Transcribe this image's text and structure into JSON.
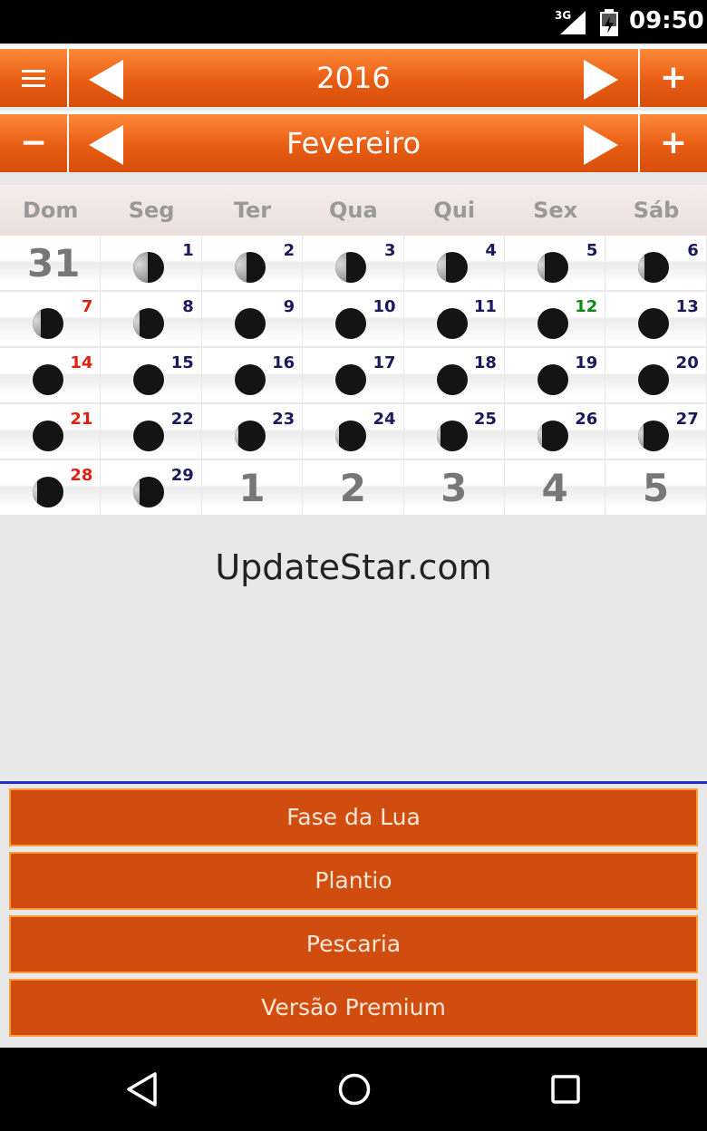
{
  "status_bar": {
    "network": "3G",
    "time": "09:50"
  },
  "year_bar": {
    "title": "2016",
    "menu_icon": "hamburger-menu-icon",
    "plus": "+"
  },
  "month_bar": {
    "title": "Fevereiro",
    "minus": "−",
    "plus": "+"
  },
  "day_names": [
    "Dom",
    "Seg",
    "Ter",
    "Qua",
    "Qui",
    "Sex",
    "Sáb"
  ],
  "calendar": {
    "rows": [
      [
        {
          "label": "31",
          "big": true
        },
        {
          "label": "1",
          "lit": 0.45
        },
        {
          "label": "2",
          "lit": 0.4
        },
        {
          "label": "3",
          "lit": 0.36
        },
        {
          "label": "4",
          "lit": 0.3
        },
        {
          "label": "5",
          "lit": 0.25
        },
        {
          "label": "6",
          "lit": 0.2
        }
      ],
      [
        {
          "label": "7",
          "lit": 0.25,
          "color": "red"
        },
        {
          "label": "8",
          "lit": 0.18
        },
        {
          "label": "9",
          "lit": 0
        },
        {
          "label": "10",
          "lit": 0
        },
        {
          "label": "11",
          "lit": 0
        },
        {
          "label": "12",
          "lit": 0,
          "color": "green"
        },
        {
          "label": "13",
          "lit": 0
        }
      ],
      [
        {
          "label": "14",
          "lit": 0,
          "color": "red"
        },
        {
          "label": "15",
          "lit": 0
        },
        {
          "label": "16",
          "lit": 0
        },
        {
          "label": "17",
          "lit": 0
        },
        {
          "label": "18",
          "lit": 0
        },
        {
          "label": "19",
          "lit": 0
        },
        {
          "label": "20",
          "lit": 0
        }
      ],
      [
        {
          "label": "21",
          "lit": 0,
          "color": "red"
        },
        {
          "label": "22",
          "lit": 0
        },
        {
          "label": "23",
          "lit": 0.12
        },
        {
          "label": "24",
          "lit": 0.12
        },
        {
          "label": "25",
          "lit": 0.14
        },
        {
          "label": "26",
          "lit": 0.16
        },
        {
          "label": "27",
          "lit": 0.18
        }
      ],
      [
        {
          "label": "28",
          "lit": 0.16,
          "color": "red"
        },
        {
          "label": "29",
          "lit": 0.18
        },
        {
          "label": "1",
          "big": true
        },
        {
          "label": "2",
          "big": true
        },
        {
          "label": "3",
          "big": true
        },
        {
          "label": "4",
          "big": true
        },
        {
          "label": "5",
          "big": true
        }
      ]
    ]
  },
  "watermark": "UpdateStar.com",
  "menu_buttons": [
    "Fase da Lua",
    "Plantio",
    "Pescaria",
    "Versão Premium"
  ],
  "colors": {
    "accent": "#e85d13",
    "button": "#d04c0f",
    "divider": "#2030c8",
    "weekend": "#e02010",
    "holiday": "#108a10",
    "day_number": "#1a1a5c"
  }
}
